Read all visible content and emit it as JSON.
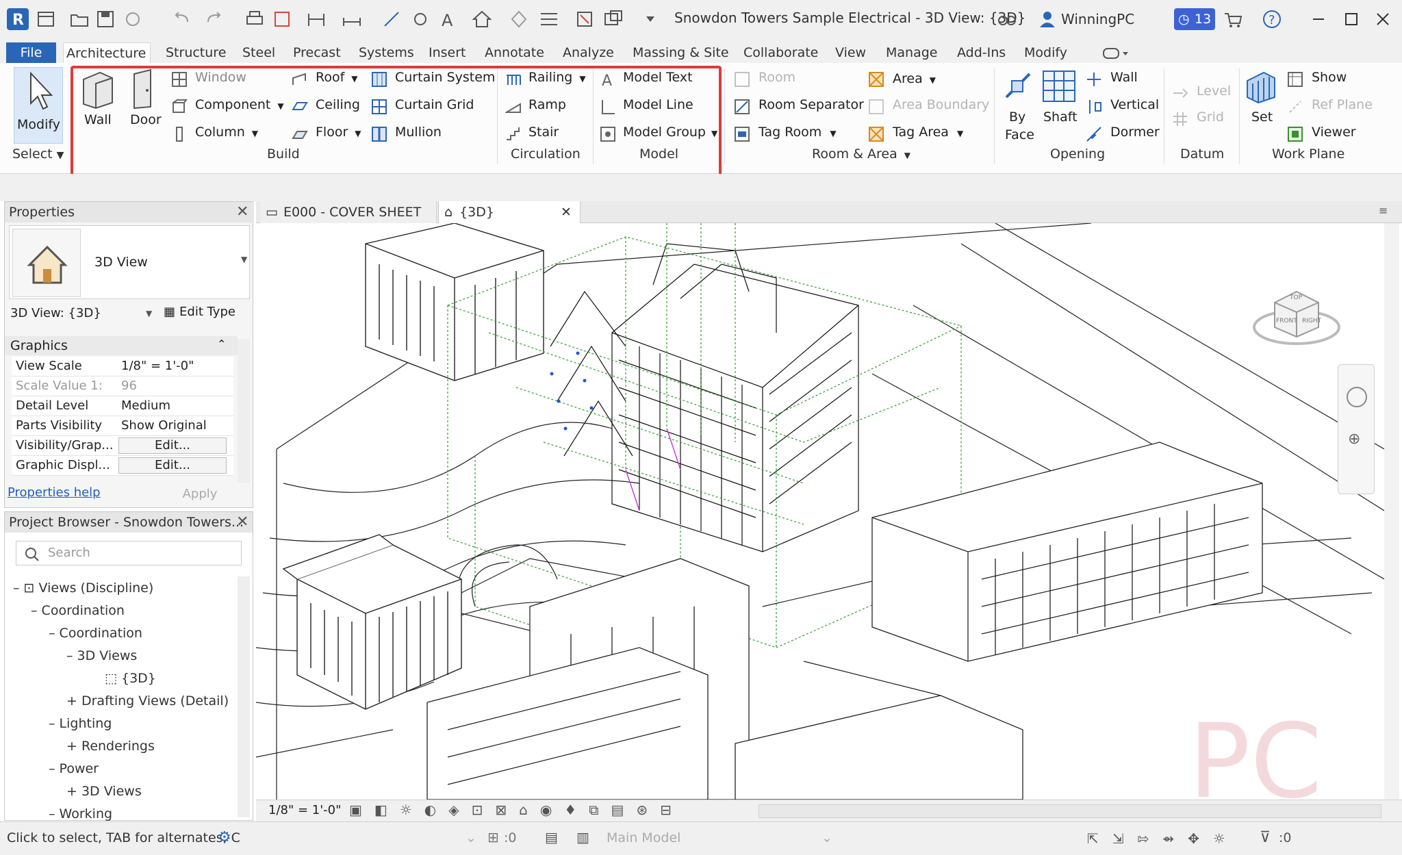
{
  "window": {
    "title": "Snowdon Towers Sample Electrical - 3D View: {3D}",
    "user": "WinningPC",
    "notification_count": "13"
  },
  "ribbon_tabs": [
    "File",
    "Architecture",
    "Structure",
    "Steel",
    "Precast",
    "Systems",
    "Insert",
    "Annotate",
    "Analyze",
    "Massing & Site",
    "Collaborate",
    "View",
    "Manage",
    "Add-Ins",
    "Modify"
  ],
  "ribbon": {
    "select": {
      "modify": "Modify",
      "group": "Select"
    },
    "build": {
      "wall": "Wall",
      "door": "Door",
      "window": "Window",
      "component": "Component",
      "column": "Column",
      "roof": "Roof",
      "ceiling": "Ceiling",
      "floor": "Floor",
      "curtain_system": "Curtain System",
      "curtain_grid": "Curtain Grid",
      "mullion": "Mullion",
      "group": "Build"
    },
    "circulation": {
      "railing": "Railing",
      "ramp": "Ramp",
      "stair": "Stair",
      "group": "Circulation"
    },
    "model": {
      "model_text": "Model Text",
      "model_line": "Model Line",
      "model_group": "Model Group",
      "group": "Model"
    },
    "room_area": {
      "room": "Room",
      "room_separator": "Room Separator",
      "tag_room": "Tag Room",
      "area": "Area",
      "area_boundary": "Area Boundary",
      "tag_area": "Tag Area",
      "group": "Room & Area"
    },
    "opening": {
      "by_face": "By",
      "by_face2": "Face",
      "shaft": "Shaft",
      "wall": "Wall",
      "vertical": "Vertical",
      "dormer": "Dormer",
      "group": "Opening"
    },
    "datum": {
      "level": "Level",
      "grid": "Grid",
      "group": "Datum"
    },
    "work_plane": {
      "set": "Set",
      "show": "Show",
      "ref_plane": "Ref Plane",
      "viewer": "Viewer",
      "group": "Work Plane"
    }
  },
  "properties": {
    "title": "Properties",
    "type_name": "3D View",
    "selector": "3D View: {3D}",
    "edit_type": "Edit Type",
    "section": "Graphics",
    "rows": [
      {
        "key": "View Scale",
        "value": "1/8\" = 1'-0\""
      },
      {
        "key": "Scale Value    1:",
        "value": "96"
      },
      {
        "key": "Detail Level",
        "value": "Medium"
      },
      {
        "key": "Parts Visibility",
        "value": "Show Original"
      },
      {
        "key": "Visibility/Grap...",
        "value": "Edit..."
      },
      {
        "key": "Graphic Displ...",
        "value": "Edit..."
      }
    ],
    "help_link": "Properties help",
    "apply": "Apply"
  },
  "browser": {
    "title": "Project Browser - Snowdon Towers...",
    "search_placeholder": "Search",
    "tree": [
      {
        "label": "Views (Discipline)",
        "level": 0,
        "sign": "–"
      },
      {
        "label": "Coordination",
        "level": 1,
        "sign": "–"
      },
      {
        "label": "Coordination",
        "level": 2,
        "sign": "–"
      },
      {
        "label": "3D Views",
        "level": 3,
        "sign": "–"
      },
      {
        "label": "{3D}",
        "level": 4,
        "sign": ""
      },
      {
        "label": "Drafting Views (Detail)",
        "level": 3,
        "sign": "+"
      },
      {
        "label": "Lighting",
        "level": 2,
        "sign": "–"
      },
      {
        "label": "Renderings",
        "level": 3,
        "sign": "+"
      },
      {
        "label": "Power",
        "level": 2,
        "sign": "–"
      },
      {
        "label": "3D Views",
        "level": 3,
        "sign": "+"
      },
      {
        "label": "Working",
        "level": 2,
        "sign": "–"
      }
    ]
  },
  "view_tabs": [
    {
      "label": "E000 - COVER SHEET"
    },
    {
      "label": "{3D}"
    }
  ],
  "view_control": {
    "scale": "1/8\" = 1'-0\""
  },
  "viewcube": {
    "top": "TOP",
    "front": "FRONT",
    "right": "RIGHT"
  },
  "statusbar": {
    "hint": "Click to select, TAB for alternates, C",
    "workset": ":0",
    "model": "Main Model",
    "filter": ":0"
  },
  "watermark": "PC",
  "colors": {
    "accent": "#2a66b8",
    "highlight": "#e03a3a",
    "green_lines": "#2e9e2e"
  }
}
